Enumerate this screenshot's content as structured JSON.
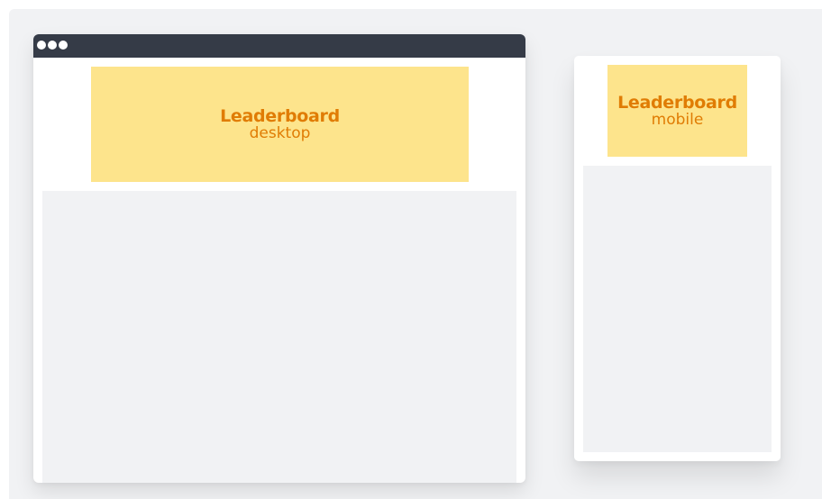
{
  "desktop": {
    "ad_title": "Leaderboard",
    "ad_subtitle": "desktop"
  },
  "mobile": {
    "ad_title": "Leaderboard",
    "ad_subtitle": "mobile"
  },
  "colors": {
    "page_background": "#f1f2f4",
    "titlebar": "#353b47",
    "ad_fill": "#fde48c",
    "ad_text": "#e07c04",
    "content_placeholder": "#f1f2f4"
  }
}
